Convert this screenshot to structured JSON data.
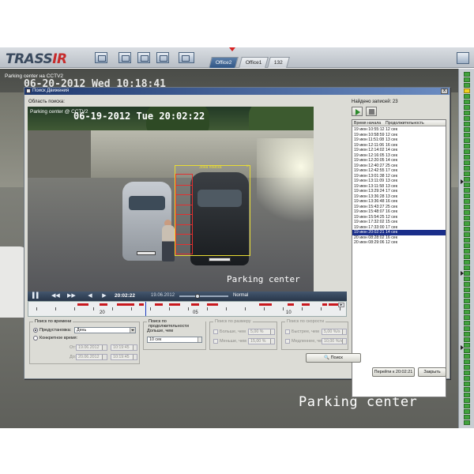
{
  "app": {
    "logo_main": "TRASS",
    "logo_accent": "IR",
    "tabs": [
      "Office2",
      "Office1",
      "132"
    ],
    "active_tab": 0
  },
  "background_camera": {
    "title": "Parking center на CCTV2",
    "date_overlay": "06-20-2012  Wed 10:18:41",
    "caption": "Parking center"
  },
  "dialog": {
    "title": "Поиск Движения",
    "close_label": "x",
    "area_label": "Область поиска:",
    "found_label": "Найдено записей: 23"
  },
  "video": {
    "title": "Parking center @ CCTV2",
    "date_overlay": "06-19-2012 Tue 20:02:22",
    "caption": "Parking center",
    "region_label": "Зона поиска",
    "region_close": "×"
  },
  "playback": {
    "time": "20:02:22",
    "date": "19.06.2012",
    "speed": "Normal",
    "buttons": [
      "▌▌",
      "◀◀",
      "▶▶",
      "◀",
      "▶"
    ]
  },
  "timeline": {
    "labels": [
      "20",
      "05",
      "10"
    ]
  },
  "results": {
    "headers": [
      "Время начала",
      "Продолжительность"
    ],
    "rows": [
      [
        "19 июн 10:55:12",
        "12 сек"
      ],
      [
        "19 июн 10:58:59",
        "12 сек"
      ],
      [
        "19 июн 11:51:08",
        "13 сек"
      ],
      [
        "19 июн 12:11:06",
        "16 сек"
      ],
      [
        "19 июн 12:14:02",
        "14 сек"
      ],
      [
        "19 июн 12:16:05",
        "13 сек"
      ],
      [
        "19 июн 12:20:05",
        "14 сек"
      ],
      [
        "19 июн 12:40:27",
        "25 сек"
      ],
      [
        "19 июн 12:42:55",
        "17 сек"
      ],
      [
        "19 июн 13:01:38",
        "12 сек"
      ],
      [
        "19 июн 13:11:09",
        "13 сек"
      ],
      [
        "19 июн 13:11:58",
        "13 сек"
      ],
      [
        "19 июн 13:29:24",
        "17 сек"
      ],
      [
        "19 июн 13:36:28",
        "13 сек"
      ],
      [
        "19 июн 13:36:48",
        "16 сек"
      ],
      [
        "19 июн 15:43:27",
        "25 сек"
      ],
      [
        "19 июн 15:48:07",
        "16 сек"
      ],
      [
        "19 июн 15:54:25",
        "12 сек"
      ],
      [
        "19 июн 17:32:02",
        "15 сек"
      ],
      [
        "19 июн 17:33:00",
        "17 сек"
      ],
      [
        "19 июн 20:02:21",
        "14 сек"
      ],
      [
        "20 июн 08:28:02",
        "16 сек"
      ],
      [
        "20 июн 08:29:06",
        "12 сек"
      ]
    ],
    "selected_row": 20
  },
  "time_search": {
    "title": "Поиск по времени",
    "preset_label": "Предустановка:",
    "preset_value": "День",
    "exact_label": "Конкретное время:",
    "from_label": "От:",
    "from_date": "19.06.2012",
    "from_time": "10:19:45",
    "to_label": "До:",
    "to_date": "20.06.2012",
    "to_time": "10:19:45"
  },
  "duration_search": {
    "title": "Поиск по продолжительности",
    "longer_label": "Дольше, чем",
    "longer_value": "10 сек"
  },
  "size_search": {
    "title": "Поиск по размеру",
    "bigger_label": "Больше, чем",
    "bigger_value": "5,00 %",
    "smaller_label": "Меньше, чем",
    "smaller_value": "15,00 %"
  },
  "speed_search": {
    "title": "Поиск по скорости",
    "faster_label": "Быстрее, чем",
    "faster_value": "5,00 %/s",
    "slower_label": "Медленнее, чем",
    "slower_value": "10,00 %/s"
  },
  "buttons": {
    "search": "Поиск",
    "goto": "Перейти к 20:02:21",
    "close": "Закрыть"
  }
}
